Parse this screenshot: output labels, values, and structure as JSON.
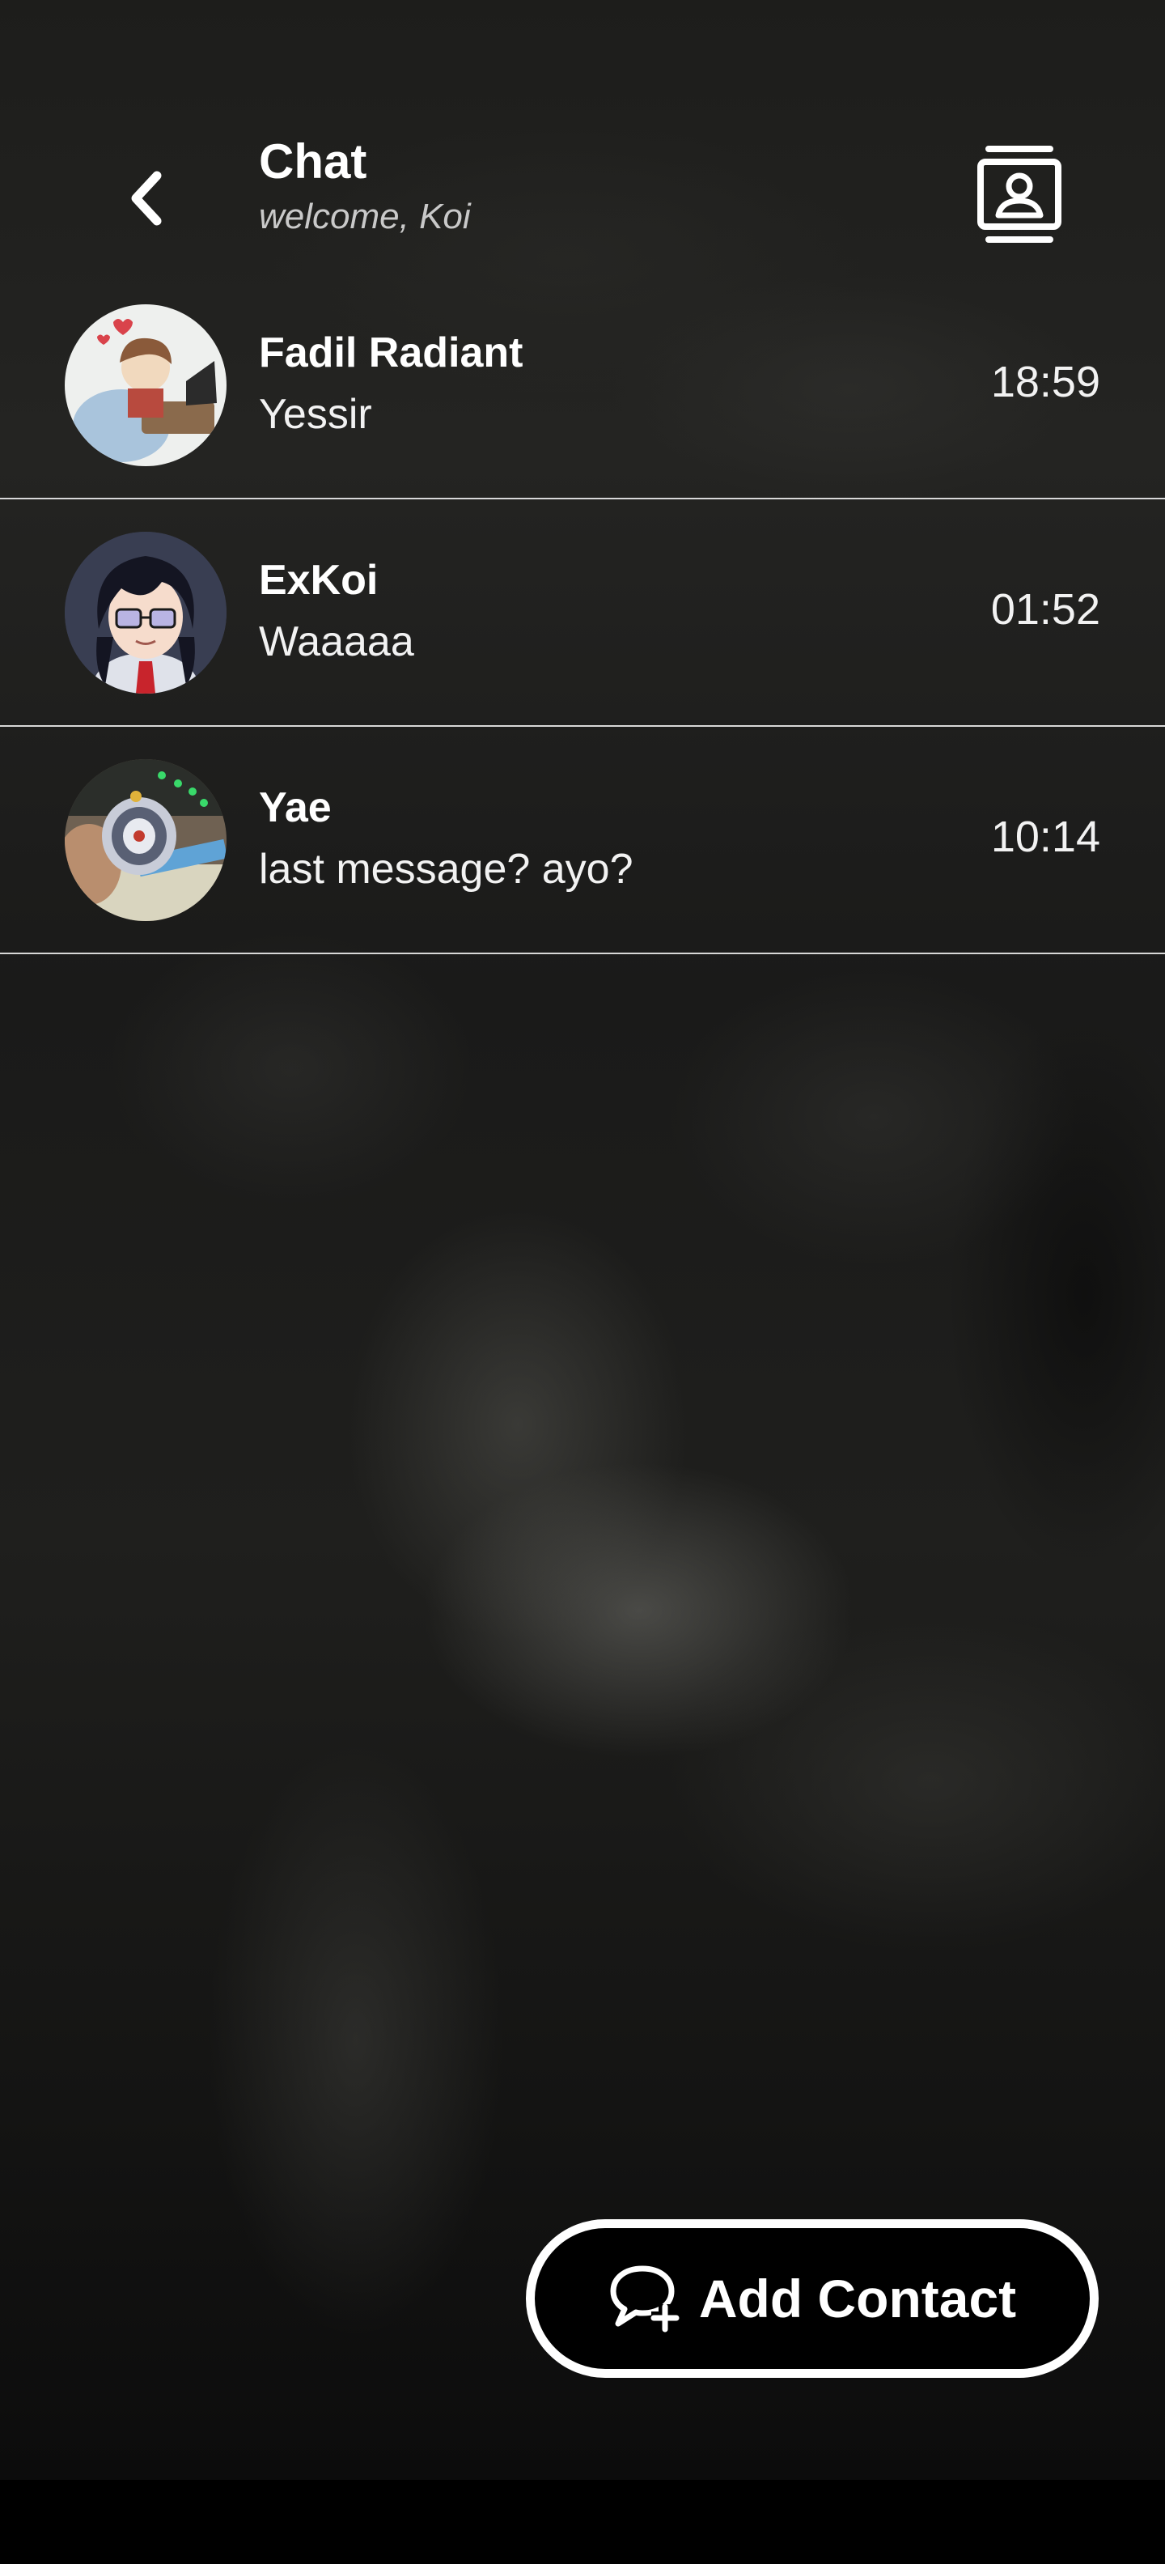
{
  "header": {
    "title": "Chat",
    "subtitle": "welcome, Koi",
    "back_icon": "chevron-left-icon",
    "contacts_icon": "contact-card-icon"
  },
  "chats": [
    {
      "name": "Fadil Radiant",
      "last_message": "Yessir",
      "time": "18:59"
    },
    {
      "name": "ExKoi",
      "last_message": "Waaaaa",
      "time": "01:52"
    },
    {
      "name": "Yae",
      "last_message": "last message? ayo?",
      "time": "10:14"
    }
  ],
  "add_contact": {
    "label": "Add Contact",
    "icon": "chat-add-icon"
  },
  "colors": {
    "text": "#ffffff",
    "divider": "#d8d8d8",
    "button_background": "#000000",
    "button_border": "#ffffff"
  }
}
